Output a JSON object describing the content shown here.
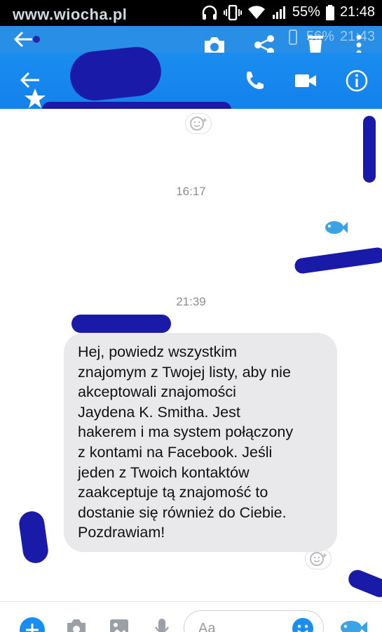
{
  "watermark": "www.wiocha.pl",
  "status": {
    "battery": "55%",
    "time": "21:48"
  },
  "ghost_status": {
    "battery": "56%",
    "time": "21:43"
  },
  "timestamps": [
    "16:17",
    "21:39"
  ],
  "message": {
    "text": "Hej, powiedz wszystkim\nznajomym z Twojej listy, aby nie\nakceptowali znajomości\nJaydena K. Smitha. Jest\nhakerem i ma system połączony\nz kontami na Facebook. Jeśli\njeden z Twoich kontaktów\nzaakceptuje tą znajomość to\ndostanie się również do Ciebie.\nPozdrawiam!"
  },
  "composer": {
    "placeholder": "Aa"
  },
  "colors": {
    "header_blue": "#1a8df0",
    "scribble": "#1a1aa8",
    "bubble": "#e9e9eb"
  },
  "icons": [
    "camera-icon",
    "share-icon",
    "trash-icon",
    "more-icon",
    "back-arrow-icon",
    "phone-icon",
    "video-icon",
    "info-icon",
    "add-icon",
    "photo-icon",
    "mic-icon",
    "emoji-icon",
    "fish-icon"
  ]
}
